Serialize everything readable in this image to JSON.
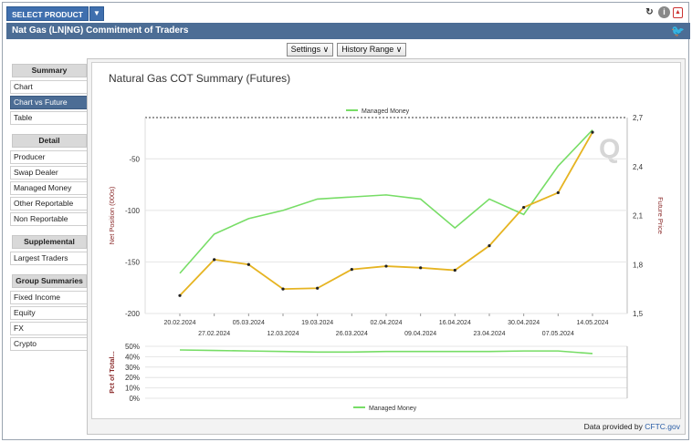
{
  "toolbar": {
    "select_product": "SELECT PRODUCT",
    "dropdown_arrow": "▼"
  },
  "page_title": "Nat Gas (LN|NG) Commitment of Traders",
  "controls": {
    "settings": "Settings ∨",
    "history_range": "History Range ∨"
  },
  "sidebar": {
    "summary": {
      "heading": "Summary",
      "items": [
        "Chart",
        "Chart vs Future",
        "Table"
      ],
      "active": 1
    },
    "detail": {
      "heading": "Detail",
      "items": [
        "Producer",
        "Swap Dealer",
        "Managed Money",
        "Other Reportable",
        "Non Reportable"
      ]
    },
    "supplemental": {
      "heading": "Supplemental",
      "items": [
        "Largest Traders"
      ]
    },
    "group_summaries": {
      "heading": "Group Summaries",
      "items": [
        "Fixed Income",
        "Equity",
        "FX",
        "Crypto"
      ]
    }
  },
  "footer": {
    "prefix": "Data provided by ",
    "source": "CFTC.gov"
  },
  "icons": [
    "refresh-icon",
    "info-icon",
    "pdf-icon",
    "twitter-icon",
    "chevron-down-icon"
  ],
  "colors": {
    "accent": "#4c6d95",
    "button": "#3f6fae",
    "managed_money": "#77dd66",
    "future_price": "#e6b422"
  },
  "chart_data": [
    {
      "type": "line",
      "title": "Natural Gas COT Summary (Futures)",
      "ylabel": "Net Position (000s)",
      "y2label": "Future Price",
      "legend": [
        "Managed Money"
      ],
      "legend_position": "top",
      "x": [
        "20.02.2024",
        "27.02.2024",
        "05.03.2024",
        "12.03.2024",
        "19.03.2024",
        "26.03.2024",
        "02.04.2024",
        "09.04.2024",
        "16.04.2024",
        "23.04.2024",
        "30.04.2024",
        "07.05.2024",
        "14.05.2024"
      ],
      "ylim": [
        -200,
        -10
      ],
      "y_ticks": [
        "-200",
        "-150",
        "-100",
        "-50"
      ],
      "y2lim": [
        1.5,
        2.7
      ],
      "y2_ticks": [
        "1,5",
        "1,8",
        "2,1",
        "2,4",
        "2,7"
      ],
      "series": [
        {
          "name": "Managed Money",
          "axis": "left",
          "color": "#77dd66",
          "values": [
            -161,
            -123,
            -108,
            -100,
            -89,
            -87,
            -85,
            -89,
            -117,
            -89,
            -104,
            -57,
            -22
          ]
        },
        {
          "axis": "right",
          "color": "#e6b422",
          "values": [
            1.61,
            1.83,
            1.8,
            1.65,
            1.655,
            1.77,
            1.79,
            1.78,
            1.765,
            1.915,
            2.15,
            2.24,
            2.61
          ]
        }
      ]
    },
    {
      "type": "line",
      "ylabel": "Pct of Total...",
      "ylim": [
        0,
        50
      ],
      "y_ticks": [
        "0%",
        "10%",
        "20%",
        "30%",
        "40%",
        "50%"
      ],
      "legend": [
        "Managed Money"
      ],
      "legend_position": "bottom",
      "series": [
        {
          "name": "Managed Money",
          "color": "#77dd66",
          "values": [
            46.5,
            46,
            45.5,
            45,
            44.5,
            44.5,
            45,
            45,
            45,
            45,
            45.5,
            45.5,
            43
          ]
        }
      ]
    }
  ]
}
